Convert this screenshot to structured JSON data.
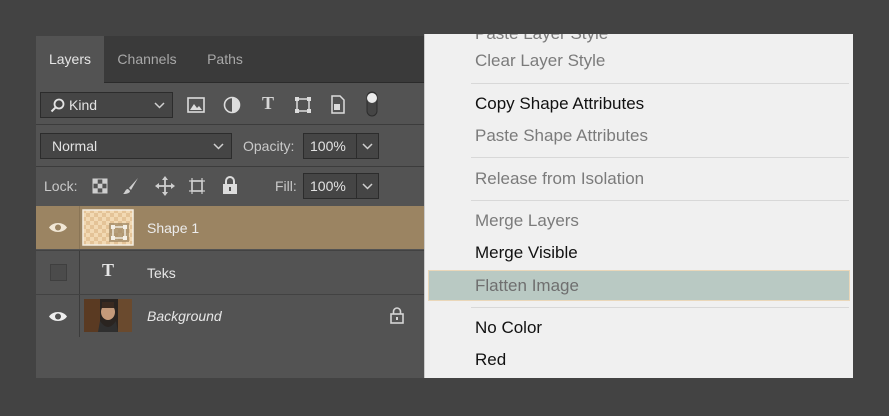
{
  "panel": {
    "tabs": [
      {
        "label": "Layers",
        "active": true
      },
      {
        "label": "Channels",
        "active": false
      },
      {
        "label": "Paths",
        "active": false
      }
    ],
    "filter": {
      "kind_label": "Kind",
      "icons": [
        "image-filter-icon",
        "adjustment-filter-icon",
        "type-filter-icon",
        "shape-filter-icon",
        "smart-object-filter-icon",
        "filter-toggle-icon"
      ]
    },
    "blend": {
      "mode": "Normal",
      "opacity_label": "Opacity:",
      "opacity_value": "100%"
    },
    "lock": {
      "label": "Lock:",
      "fill_label": "Fill:",
      "fill_value": "100%"
    },
    "layers": [
      {
        "name": "Shape 1",
        "visible": true,
        "selected": true,
        "italic": false
      },
      {
        "name": "Teks",
        "visible": false,
        "selected": false,
        "italic": false
      },
      {
        "name": "Background",
        "visible": true,
        "selected": false,
        "italic": true,
        "locked": true
      }
    ],
    "colors": {
      "selected_row": "#9b8462",
      "panel_bg": "#535353"
    }
  },
  "context_menu": {
    "items": [
      {
        "label": "Paste Layer Style",
        "enabled": false,
        "partial": true
      },
      {
        "label": "Clear Layer Style",
        "enabled": false
      },
      {
        "label": "Copy Shape Attributes",
        "enabled": true
      },
      {
        "label": "Paste Shape Attributes",
        "enabled": false
      },
      {
        "label": "Release from Isolation",
        "enabled": false
      },
      {
        "label": "Merge Layers",
        "enabled": false
      },
      {
        "label": "Merge Visible",
        "enabled": true
      },
      {
        "label": "Flatten Image",
        "enabled": false,
        "highlighted": true
      },
      {
        "label": "No Color",
        "enabled": true
      },
      {
        "label": "Red",
        "enabled": true
      }
    ],
    "colors": {
      "highlight": "#b9c9c3",
      "highlight_border": "#ead7b9"
    }
  }
}
